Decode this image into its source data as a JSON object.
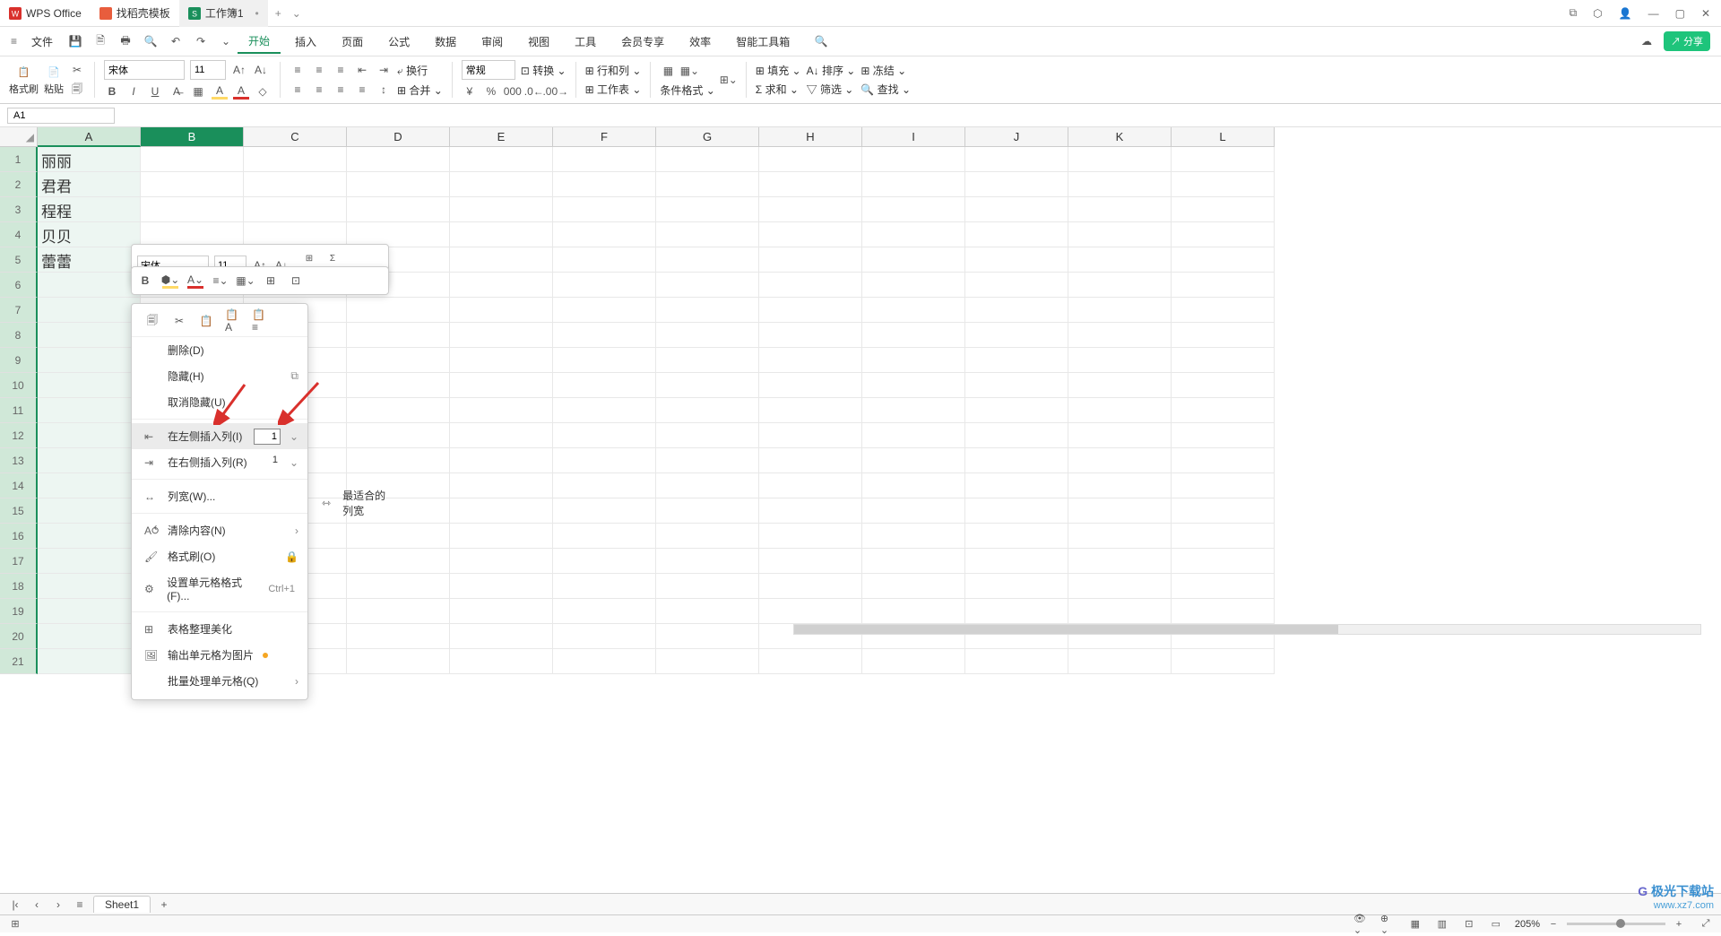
{
  "titlebar": {
    "tab1": "WPS Office",
    "tab2": "找稻壳模板",
    "tab3": "工作簿1"
  },
  "menubar": {
    "file": "文件",
    "items": [
      "开始",
      "插入",
      "页面",
      "公式",
      "数据",
      "审阅",
      "视图",
      "工具",
      "会员专享",
      "效率",
      "智能工具箱"
    ]
  },
  "ribbon": {
    "format_brush": "格式刷",
    "paste": "粘贴",
    "font": "宋体",
    "size": "11",
    "wrap": "换行",
    "merge": "合并",
    "general": "常规",
    "convert": "转换",
    "rowcol": "行和列",
    "sheet": "工作表",
    "cond_format": "条件格式",
    "fill": "填充",
    "sort": "排序",
    "freeze": "冻结",
    "sum": "求和",
    "filter": "筛选",
    "find": "查找"
  },
  "namebox": "A1",
  "mini_toolbar": {
    "font": "宋体",
    "size": "11",
    "merge": "合并",
    "sum": "求和"
  },
  "columns": [
    "A",
    "B",
    "C",
    "D",
    "E",
    "F",
    "G",
    "H",
    "I",
    "J",
    "K",
    "L"
  ],
  "rows": [
    "1",
    "2",
    "3",
    "4",
    "5",
    "6",
    "7",
    "8",
    "9",
    "10",
    "11",
    "12",
    "13",
    "14",
    "15",
    "16",
    "17",
    "18",
    "19",
    "20",
    "21"
  ],
  "cells": {
    "A1": "丽丽",
    "A2": "君君",
    "A3": "程程",
    "A4": "贝贝",
    "A5": "蕾蕾"
  },
  "context_menu": {
    "delete": "删除(D)",
    "hide": "隐藏(H)",
    "unhide": "取消隐藏(U)",
    "insert_left": "在左侧插入列(I)",
    "insert_left_val": "1",
    "insert_right": "在右侧插入列(R)",
    "insert_right_val": "1",
    "col_width": "列宽(W)...",
    "best_width": "最适合的列宽",
    "clear": "清除内容(N)",
    "format_brush": "格式刷(O)",
    "cell_format": "设置单元格格式(F)...",
    "cell_format_key": "Ctrl+1",
    "beautify": "表格整理美化",
    "export_img": "输出单元格为图片",
    "batch": "批量处理单元格(Q)"
  },
  "sheet_tab": "Sheet1",
  "zoom": "205%",
  "share": "分享",
  "watermark": {
    "name": "极光下载站",
    "url": "www.xz7.com"
  }
}
